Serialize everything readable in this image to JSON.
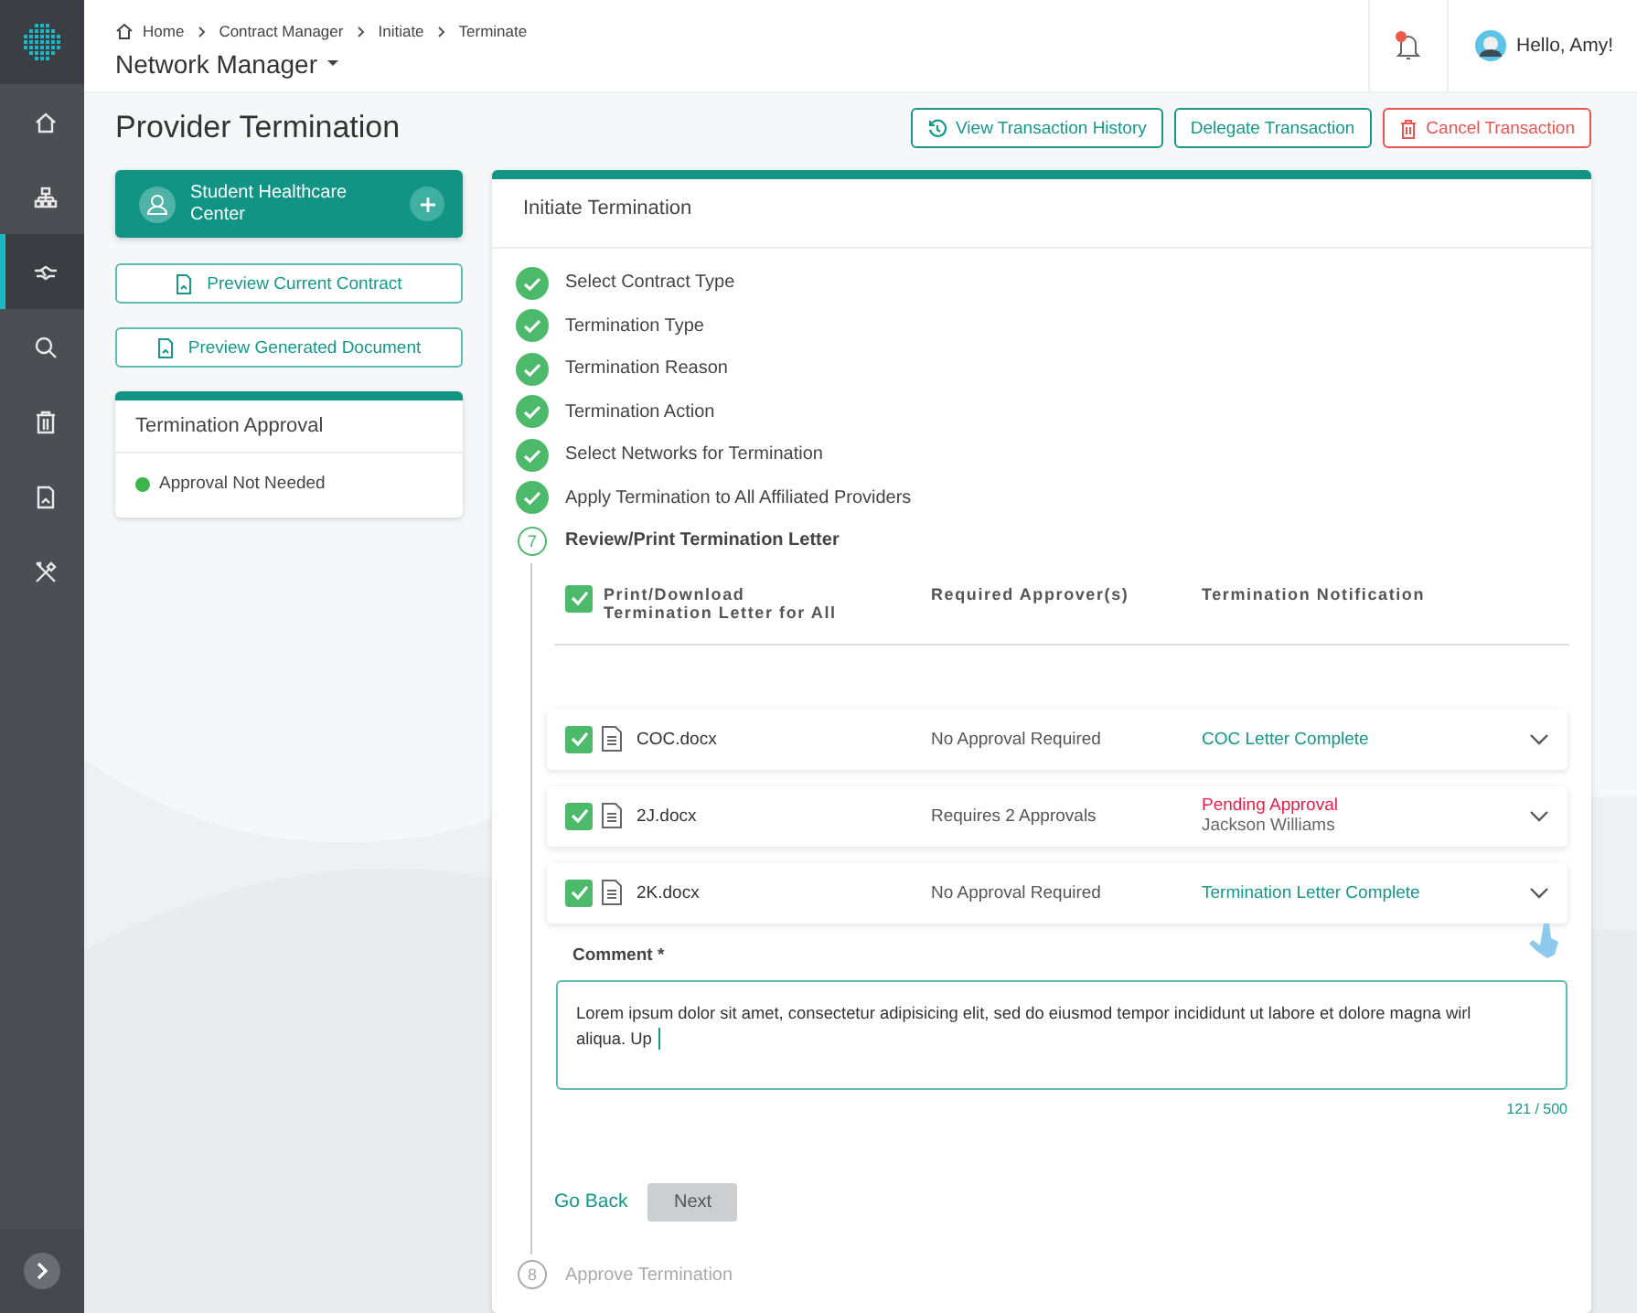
{
  "sidebar": {
    "items": [
      {
        "kind": "home",
        "selected": false
      },
      {
        "kind": "org",
        "selected": false
      },
      {
        "kind": "handshake",
        "selected": true
      },
      {
        "kind": "search",
        "selected": false
      },
      {
        "kind": "trash",
        "selected": false
      },
      {
        "kind": "document",
        "selected": false
      },
      {
        "kind": "tools",
        "selected": false
      }
    ]
  },
  "breadcrumb": [
    "Home",
    "Contract Manager",
    "Initiate",
    "Terminate"
  ],
  "app_title": "Network Manager",
  "notifications": {
    "unread": true
  },
  "user": {
    "greeting": "Hello, Amy!"
  },
  "page_title": "Provider Termination",
  "actions": [
    {
      "kind": "history",
      "label": "View Transaction History"
    },
    {
      "kind": "plain",
      "label": "Delegate Transaction"
    },
    {
      "kind": "danger",
      "label": "Cancel Transaction"
    }
  ],
  "provider": {
    "name": "Student Healthcare Center"
  },
  "previews": [
    "Preview Current Contract",
    "Preview Generated Document"
  ],
  "approval": {
    "title": "Termination Approval",
    "status": "Approval Not Needed",
    "color": "#3cb54a"
  },
  "wizard": {
    "title": "Initiate Termination",
    "steps": [
      {
        "label": "Select Contract Type",
        "kind": "done"
      },
      {
        "label": "Termination Type",
        "kind": "done"
      },
      {
        "label": "Termination Reason",
        "kind": "done"
      },
      {
        "label": "Termination Action",
        "kind": "done"
      },
      {
        "label": "Select Networks for Termination",
        "kind": "done"
      },
      {
        "label": "Apply Termination to All Affiliated Providers",
        "kind": "done"
      },
      {
        "number": "7",
        "label": "Review/Print Termination Letter",
        "kind": "current"
      },
      {
        "number": "8",
        "label": "Approve Termination",
        "kind": "pending"
      }
    ],
    "table": {
      "select_all": {
        "label": "Print/Download Termination Letter for All",
        "checked": true
      },
      "columns": [
        "Required Approver(s)",
        "Termination Notification"
      ],
      "rows": [
        {
          "file": "COC.docx",
          "checked": true,
          "approvers": "No Approval Required",
          "notification": "COC Letter Complete",
          "kind": "complete"
        },
        {
          "file": "2J.docx",
          "checked": true,
          "approvers": "Requires 2 Approvals",
          "notification": "Pending Approval",
          "detail": "Jackson Williams",
          "kind": "pending"
        },
        {
          "file": "2K.docx",
          "checked": true,
          "approvers": "No Approval Required",
          "notification": "Termination Letter Complete",
          "kind": "complete"
        }
      ]
    },
    "comment": {
      "label": "Comment *",
      "value": "Lorem ipsum dolor sit amet, consectetur  adipisicing elit, sed do eiusmod tempor incididunt ut labore et dolore magna wirl aliqua. Up",
      "counter": "121 / 500"
    },
    "back": "Go Back",
    "next": {
      "label": "Next",
      "disabled": true
    }
  }
}
